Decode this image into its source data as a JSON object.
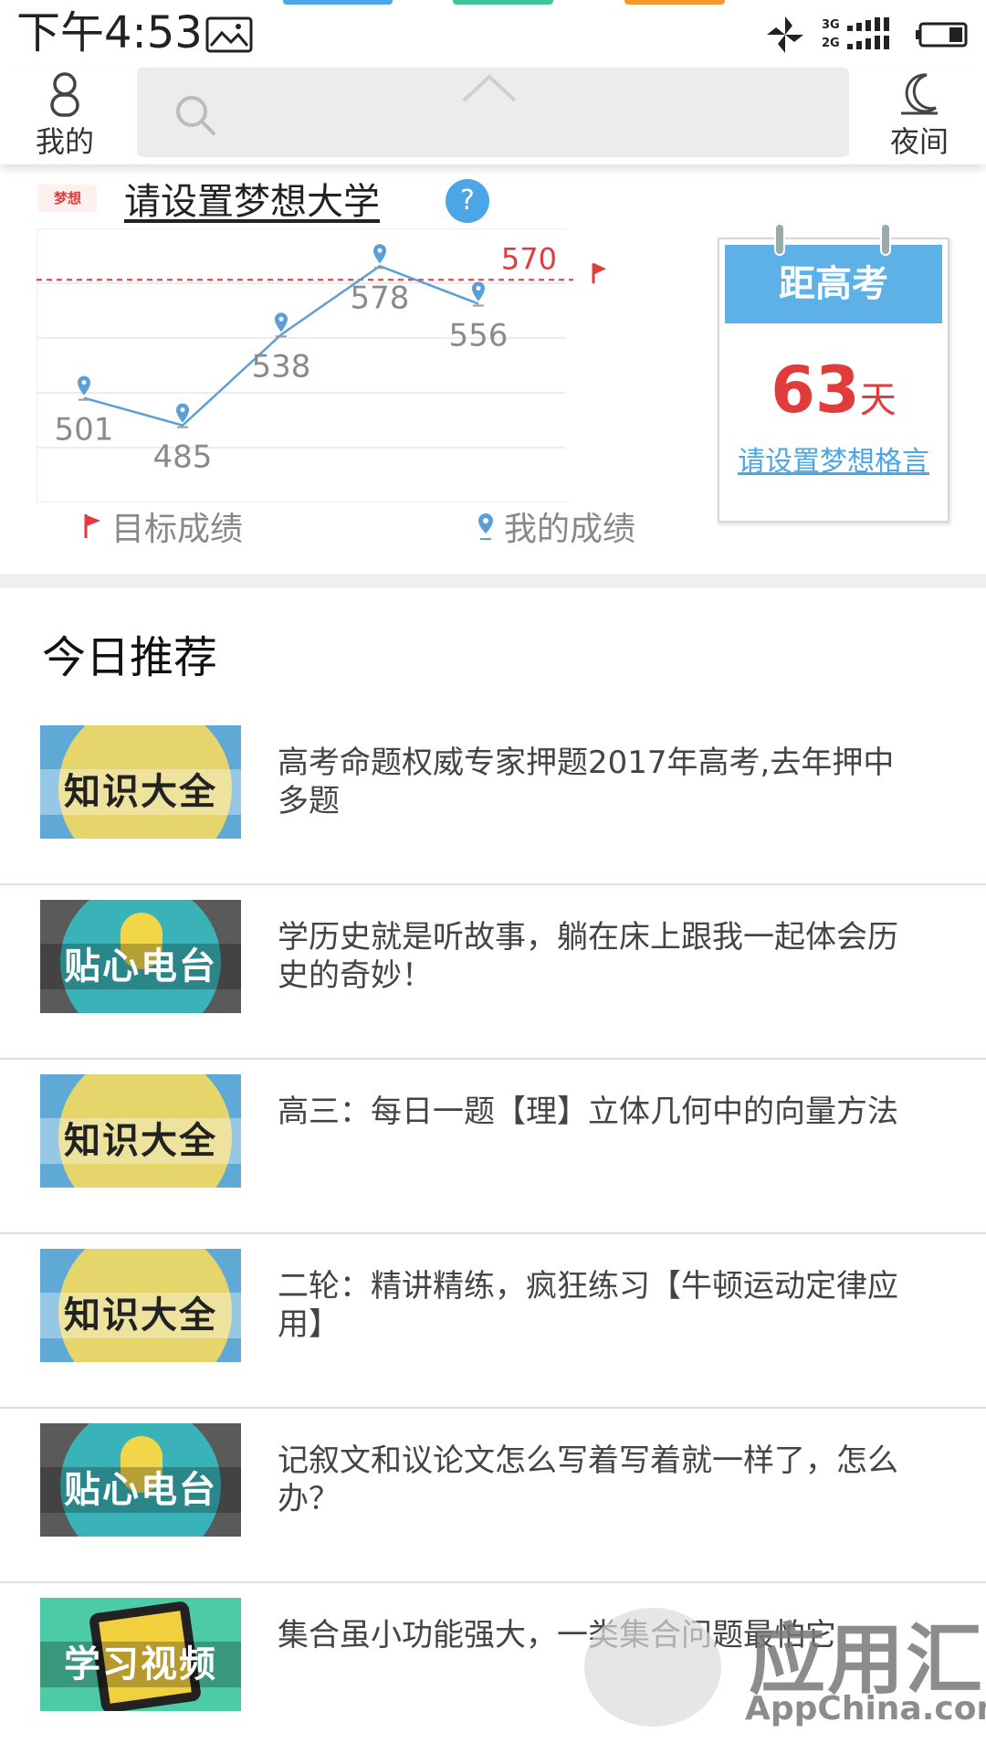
{
  "status_bar": {
    "time": "下午4:53",
    "net_3g": "3G",
    "net_2g": "2G",
    "tab_colors": [
      "#4aa6e6",
      "#3fc39a",
      "#f39a2b"
    ]
  },
  "top_bar": {
    "mine_label": "我的",
    "night_label": "夜间",
    "search_placeholder": ""
  },
  "dream": {
    "logo_text": "梦想",
    "title": "请设置梦想大学",
    "help": "?",
    "legend_target": "目标成绩",
    "legend_mine": "我的成绩"
  },
  "chart_data": {
    "type": "line",
    "series": [
      {
        "values": [
          501,
          485,
          538,
          578,
          556
        ]
      }
    ],
    "target_value": 570,
    "target_label": "570",
    "point_labels": [
      "501",
      "485",
      "538",
      "578",
      "556"
    ],
    "legend": [
      "目标成绩",
      "我的成绩"
    ],
    "colors": {
      "line": "#5aa0d6",
      "target": "#e23b3b"
    }
  },
  "countdown": {
    "header": "距高考",
    "days": "63",
    "unit": "天",
    "motto": "请设置梦想格言"
  },
  "recommend": {
    "title": "今日推荐",
    "items": [
      {
        "tag": "知识大全",
        "kind": "knowledge",
        "text": "高考命题权威专家押题2017年高考,去年押中多题"
      },
      {
        "tag": "贴心电台",
        "kind": "radio",
        "text": "学历史就是听故事，躺在床上跟我一起体会历史的奇妙！"
      },
      {
        "tag": "知识大全",
        "kind": "knowledge",
        "text": "高三：每日一题【理】立体几何中的向量方法"
      },
      {
        "tag": "知识大全",
        "kind": "knowledge",
        "text": "二轮：精讲精练，疯狂练习【牛顿运动定律应用】"
      },
      {
        "tag": "贴心电台",
        "kind": "radio",
        "text": "记叙文和议论文怎么写着写着就一样了，怎么办？"
      },
      {
        "tag": "学习视频",
        "kind": "video",
        "text": "集合虽小功能强大，一类集合问题最怕它"
      }
    ]
  },
  "watermark": {
    "main": "应用汇",
    "sub": "AppChina.com"
  }
}
